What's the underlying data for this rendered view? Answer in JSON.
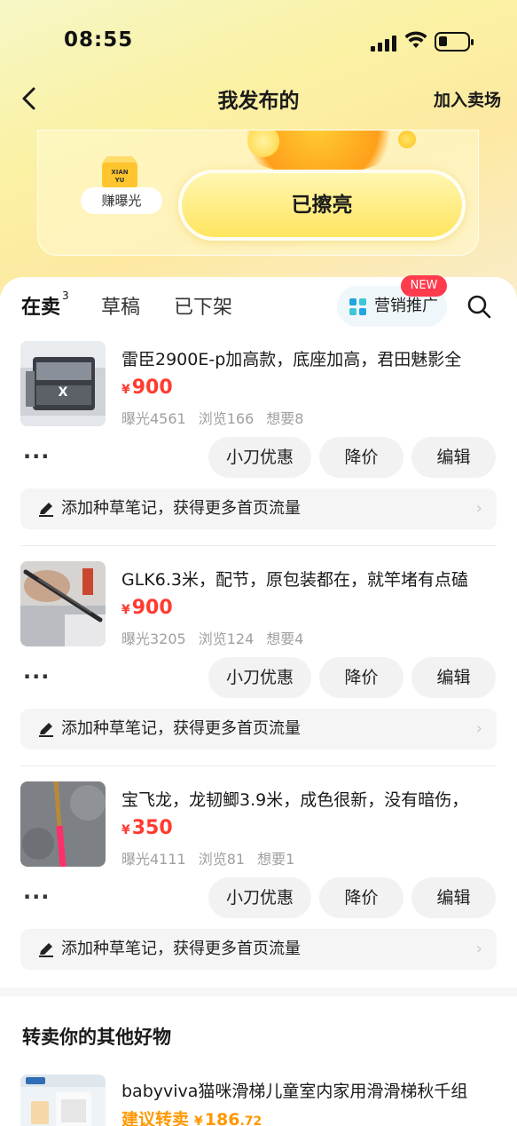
{
  "status_bar": {
    "time": "08:55"
  },
  "nav": {
    "title": "我发布的",
    "right_action": "加入卖场"
  },
  "promo": {
    "box_label": "XIAN\nYU",
    "earn_label": "赚曝光",
    "shine_button": "已擦亮"
  },
  "tabs": [
    {
      "label": "在卖",
      "count": "3",
      "active": true
    },
    {
      "label": "草稿",
      "active": false
    },
    {
      "label": "已下架",
      "active": false
    }
  ],
  "marketing": {
    "label": "营销推广",
    "badge": "NEW"
  },
  "item_actions": {
    "more": "···",
    "discount": "小刀优惠",
    "reduce": "降价",
    "edit": "编辑"
  },
  "note_prompt": "添加种草笔记，获得更多首页流量",
  "items": [
    {
      "title": "雷臣2900E-p加高款，底座加高，君田魅影全",
      "currency": "¥",
      "price": "900",
      "exposure": "曝光4561",
      "views": "浏览166",
      "wants": "想要8"
    },
    {
      "title": "GLK6.3米，配节，原包装都在，就竿堵有点磕",
      "currency": "¥",
      "price": "900",
      "exposure": "曝光3205",
      "views": "浏览124",
      "wants": "想要4"
    },
    {
      "title": "宝飞龙，龙韧鲫3.9米，成色很新，没有暗伤，",
      "currency": "¥",
      "price": "350",
      "exposure": "曝光4111",
      "views": "浏览81",
      "wants": "想要1"
    }
  ],
  "other": {
    "section_title": "转卖你的其他好物",
    "rec": {
      "title": "babyviva猫咪滑梯儿童室内家用滑滑梯秋千组",
      "suggest_label": "建议转卖",
      "currency": "¥",
      "price_int": "186",
      "price_dec": ".72"
    }
  },
  "colors": {
    "accent_yellow": "#ffe11a",
    "price_red": "#ff3b30",
    "badge_red": "#ff3b4d",
    "suggest_orange": "#ff9800"
  }
}
